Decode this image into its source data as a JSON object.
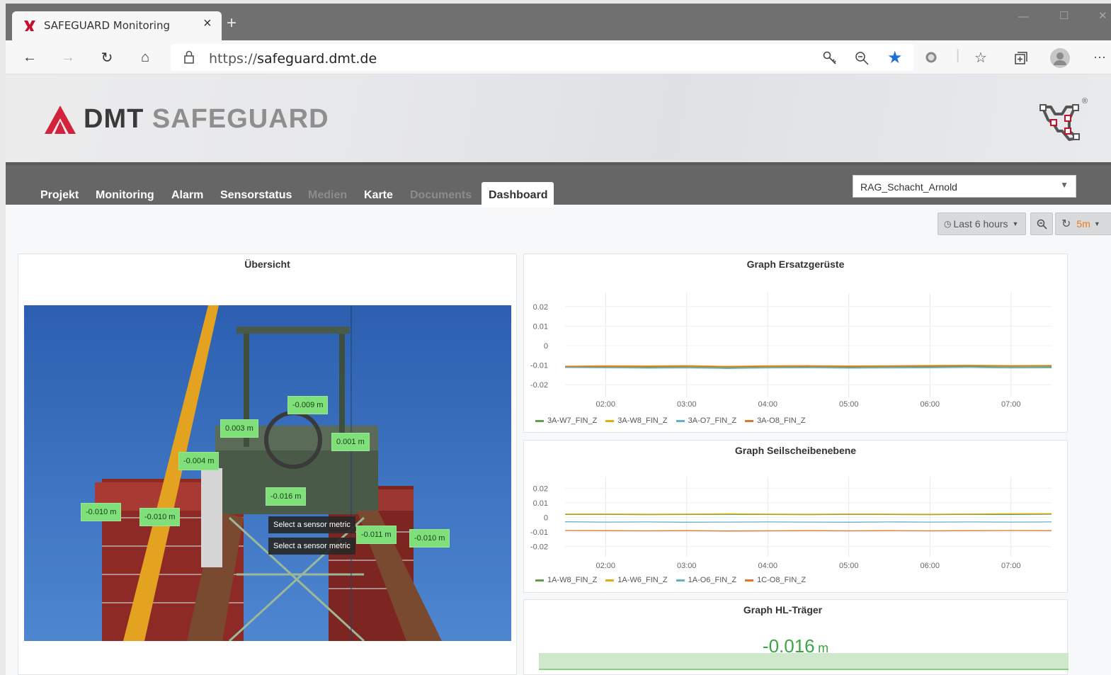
{
  "browser": {
    "tab_title": "SAFEGUARD Monitoring",
    "tab_close": "×",
    "new_tab": "+",
    "url_prefix": "https://",
    "url_domain": "safeguard.dmt.de",
    "menu": "···"
  },
  "header": {
    "logo_dmt": "DMT",
    "logo_safeguard": "SAFEGUARD",
    "registered": "®"
  },
  "nav": {
    "items": [
      {
        "label": "Projekt",
        "enabled": true
      },
      {
        "label": "Monitoring",
        "enabled": true
      },
      {
        "label": "Alarm",
        "enabled": true
      },
      {
        "label": "Sensorstatus",
        "enabled": true
      },
      {
        "label": "Medien",
        "enabled": false
      },
      {
        "label": "Karte",
        "enabled": true
      },
      {
        "label": "Documents",
        "enabled": false
      },
      {
        "label": "Dashboard",
        "enabled": true,
        "active": true
      }
    ],
    "project_select": "RAG_Schacht_Arnold"
  },
  "time_controls": {
    "range": "Last 6 hours",
    "refresh": "5m"
  },
  "overview": {
    "title": "Übersicht",
    "metrics": [
      "-0.009 m",
      "0.003 m",
      "0.001 m",
      "-0.004 m",
      "-0.016 m",
      "-0.010 m",
      "-0.010 m",
      "-0.011 m",
      "-0.010 m"
    ],
    "tooltips": [
      "Select a sensor metric",
      "Select a sensor metric"
    ]
  },
  "colors": {
    "green": "#629e51",
    "yellow": "#e5ac0e",
    "blue": "#64b0c8",
    "orange": "#e0752d",
    "metric_bg": "#7fe07a",
    "refresh_orange": "#eb7b18"
  },
  "chart_data": [
    {
      "type": "line",
      "title": "Graph Ersatzgerüste",
      "x": [
        "01:30",
        "02:00",
        "02:30",
        "03:00",
        "03:30",
        "04:00",
        "04:30",
        "05:00",
        "05:30",
        "06:00",
        "06:30",
        "07:00",
        "07:30"
      ],
      "x_ticks": [
        "02:00",
        "03:00",
        "04:00",
        "05:00",
        "06:00",
        "07:00"
      ],
      "y_ticks": [
        "0.02",
        "0.01",
        "0",
        "-0.01",
        "-0.02"
      ],
      "ylim": [
        -0.025,
        0.025
      ],
      "series": [
        {
          "name": "3A-W7_FIN_Z",
          "color": "#629e51",
          "values": [
            -0.011,
            -0.0108,
            -0.011,
            -0.0109,
            -0.0112,
            -0.0109,
            -0.0108,
            -0.011,
            -0.0109,
            -0.0108,
            -0.0107,
            -0.0109,
            -0.0108
          ]
        },
        {
          "name": "3A-W8_FIN_Z",
          "color": "#e5ac0e",
          "values": [
            -0.0105,
            -0.0103,
            -0.0104,
            -0.0102,
            -0.0106,
            -0.0103,
            -0.0102,
            -0.0104,
            -0.0103,
            -0.0101,
            -0.01,
            -0.0102,
            -0.0101
          ]
        },
        {
          "name": "3A-O7_FIN_Z",
          "color": "#64b0c8",
          "values": [
            -0.0112,
            -0.0113,
            -0.0115,
            -0.0114,
            -0.0117,
            -0.0114,
            -0.0113,
            -0.0115,
            -0.0114,
            -0.0113,
            -0.0112,
            -0.0114,
            -0.0113
          ]
        },
        {
          "name": "3A-O8_FIN_Z",
          "color": "#e0752d",
          "values": [
            -0.0107,
            -0.0106,
            -0.0107,
            -0.0105,
            -0.0108,
            -0.0106,
            -0.0105,
            -0.0106,
            -0.0105,
            -0.0104,
            -0.0102,
            -0.0104,
            -0.0103
          ]
        }
      ],
      "legend": "bottom-left",
      "grid": true
    },
    {
      "type": "line",
      "title": "Graph Seilscheibenebene",
      "x": [
        "01:30",
        "02:00",
        "02:30",
        "03:00",
        "03:30",
        "04:00",
        "04:30",
        "05:00",
        "05:30",
        "06:00",
        "06:30",
        "07:00",
        "07:30"
      ],
      "x_ticks": [
        "02:00",
        "03:00",
        "04:00",
        "05:00",
        "06:00",
        "07:00"
      ],
      "y_ticks": [
        "0.02",
        "0.01",
        "0",
        "-0.01",
        "-0.02"
      ],
      "ylim": [
        -0.025,
        0.025
      ],
      "series": [
        {
          "name": "1A-W8_FIN_Z",
          "color": "#629e51",
          "values": [
            0.002,
            0.0021,
            0.0019,
            0.002,
            0.0021,
            0.002,
            0.0019,
            0.0021,
            0.002,
            0.0019,
            0.0021,
            0.002,
            0.0022
          ]
        },
        {
          "name": "1A-W6_FIN_Z",
          "color": "#e5ac0e",
          "values": [
            0.0023,
            0.0024,
            0.0022,
            0.0023,
            0.0025,
            0.0023,
            0.0022,
            0.0024,
            0.0023,
            0.0022,
            0.0024,
            0.0025,
            0.0026
          ]
        },
        {
          "name": "1A-O6_FIN_Z",
          "color": "#64b0c8",
          "values": [
            -0.003,
            -0.0032,
            -0.0031,
            -0.0033,
            -0.0032,
            -0.0031,
            -0.0032,
            -0.0033,
            -0.0031,
            -0.0032,
            -0.0031,
            -0.0032,
            -0.0031
          ]
        },
        {
          "name": "1C-O8_FIN_Z",
          "color": "#e0752d",
          "values": [
            -0.009,
            -0.0091,
            -0.0092,
            -0.0091,
            -0.0093,
            -0.0092,
            -0.0091,
            -0.0092,
            -0.0091,
            -0.0092,
            -0.0091,
            -0.009,
            -0.0091
          ]
        }
      ],
      "legend": "bottom-left",
      "grid": true
    }
  ],
  "hl_traeger": {
    "title": "Graph HL-Träger",
    "value": "-0.016",
    "unit": "m"
  }
}
